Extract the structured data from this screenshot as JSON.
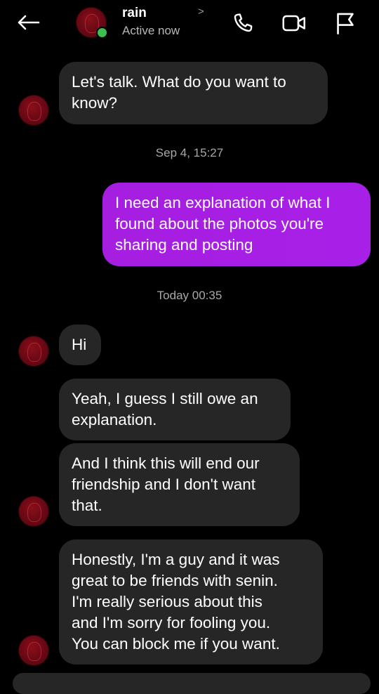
{
  "header": {
    "contact_name": "rain",
    "status": "Active now",
    "chevron": ">",
    "icons": [
      "back-arrow-icon",
      "phone-icon",
      "video-icon",
      "flag-icon"
    ],
    "online_color": "#3fbe4f"
  },
  "messages": [
    {
      "side": "incoming",
      "text": "Let's talk. What do you want to\nknow?"
    },
    {
      "type": "timestamp",
      "text": "Sep 4, 15:27"
    },
    {
      "side": "outgoing",
      "text": "I need an explanation of what I\nfound about the photos you're\nsharing and posting"
    },
    {
      "type": "timestamp",
      "text": "Today 00:35"
    },
    {
      "side": "incoming",
      "text": "Hi"
    },
    {
      "side": "incoming",
      "text": "Yeah, I guess I still owe an\nexplanation."
    },
    {
      "side": "incoming",
      "text": "And I think this will end our\nfriendship and I don't want\nthat."
    },
    {
      "side": "incoming",
      "text": "Honestly, I'm a guy and it was\ngreat to be friends with senin.\nI'm really serious about this\nand I'm sorry for fooling you.\nYou can block me if you want."
    }
  ],
  "colors": {
    "background": "#000000",
    "incoming_bubble": "#262626",
    "outgoing_bubble": "#a61ee0",
    "secondary_text": "#a8a8a8"
  }
}
